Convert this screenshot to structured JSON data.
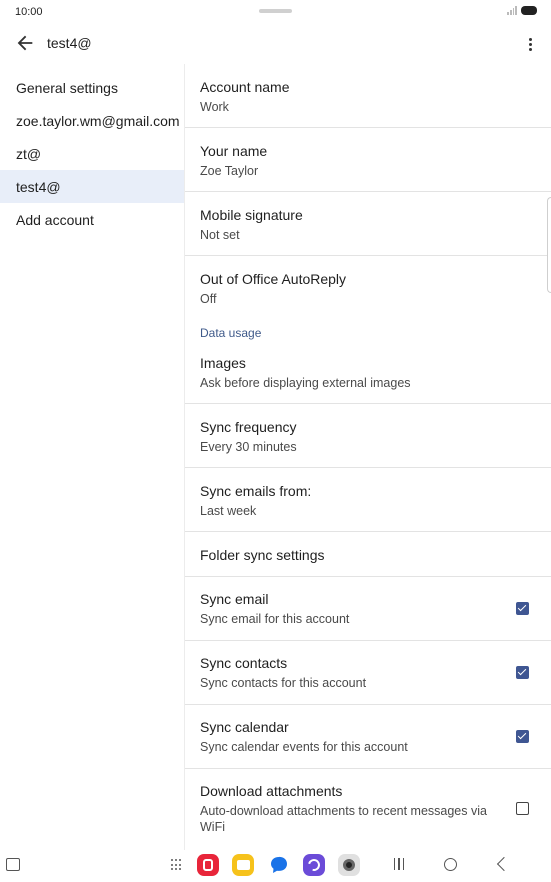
{
  "status_bar": {
    "time": "10:00"
  },
  "app_bar": {
    "title": "test4@"
  },
  "sidebar": {
    "items": [
      {
        "label": "General settings"
      },
      {
        "label": "zoe.taylor.wm@gmail.com"
      },
      {
        "label": "zt@"
      },
      {
        "label": "test4@",
        "selected": true
      },
      {
        "label": "Add account"
      }
    ]
  },
  "settings": {
    "account_name": {
      "title": "Account name",
      "value": "Work"
    },
    "your_name": {
      "title": "Your name",
      "value": "Zoe Taylor"
    },
    "mobile_signature": {
      "title": "Mobile signature",
      "value": "Not set"
    },
    "out_of_office": {
      "title": "Out of Office AutoReply",
      "value": "Off"
    },
    "data_usage_header": "Data usage",
    "images": {
      "title": "Images",
      "value": "Ask before displaying external images"
    },
    "sync_frequency": {
      "title": "Sync frequency",
      "value": "Every 30 minutes"
    },
    "sync_emails_from": {
      "title": "Sync emails from:",
      "value": "Last week"
    },
    "folder_sync": {
      "title": "Folder sync settings"
    },
    "sync_email": {
      "title": "Sync email",
      "value": "Sync email for this account",
      "checked": true
    },
    "sync_contacts": {
      "title": "Sync contacts",
      "value": "Sync contacts for this account",
      "checked": true
    },
    "sync_calendar": {
      "title": "Sync calendar",
      "value": "Sync calendar events for this account",
      "checked": true
    },
    "download_attachments": {
      "title": "Download attachments",
      "value": "Auto-download attachments to recent messages via WiFi",
      "checked": false
    }
  },
  "colors": {
    "accent": "#3f5692",
    "section_header": "#3f5a8a",
    "selected_bg": "#e8eef9"
  },
  "nav_bar": {
    "apps": [
      "red-app-icon",
      "notes-app-icon",
      "messages-app-icon",
      "internet-app-icon",
      "camera-app-icon"
    ]
  }
}
